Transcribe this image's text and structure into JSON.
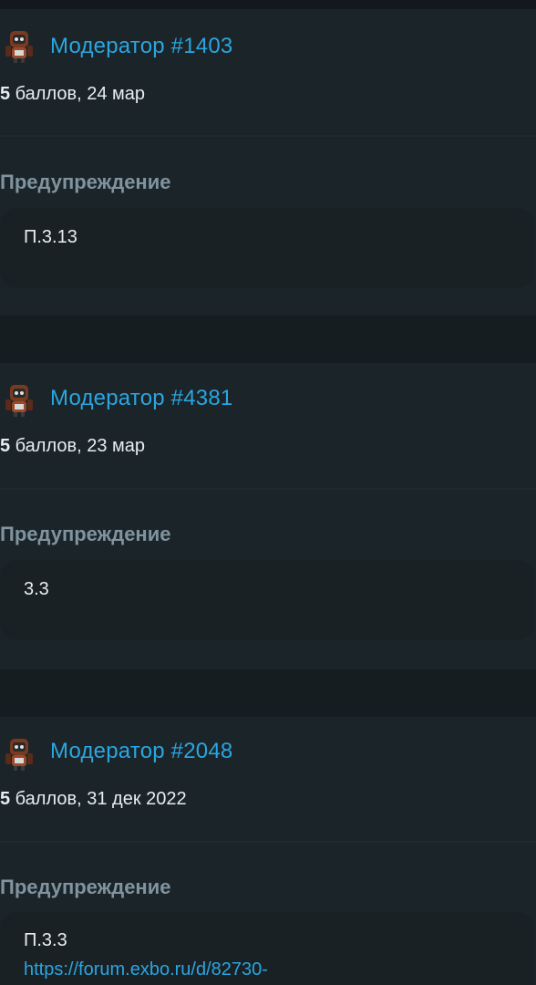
{
  "entries": [
    {
      "moderator": "Модератор #1403",
      "points": "5",
      "points_suffix": " баллов, 24 мар",
      "type_label": "Предупреждение",
      "reason": "П.3.13"
    },
    {
      "moderator": "Модератор #4381",
      "points": "5",
      "points_suffix": " баллов, 23 мар",
      "type_label": "Предупреждение",
      "reason": "3.3"
    },
    {
      "moderator": "Модератор #2048",
      "points": "5",
      "points_suffix": " баллов, 31 дек 2022",
      "type_label": "Предупреждение",
      "reason": "П.3.3",
      "link": "https://forum.exbo.ru/d/82730-"
    }
  ],
  "colors": {
    "accent": "#2aa6e0",
    "label": "#8094a0",
    "card": "#1b2428",
    "background": "#161d21"
  },
  "icons": {
    "avatar": "robot-avatar-icon"
  }
}
